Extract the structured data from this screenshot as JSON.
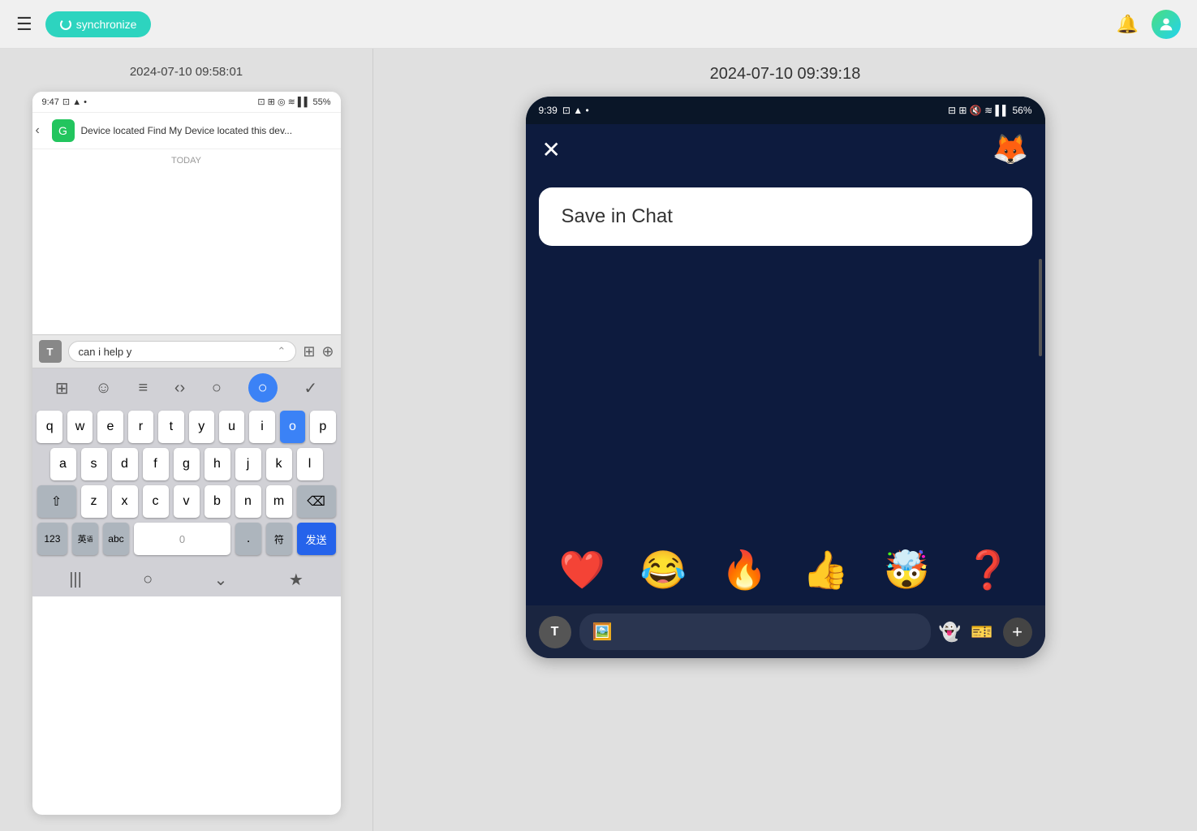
{
  "topbar": {
    "sync_label": "synchronize",
    "bell_label": "🔔",
    "avatar_label": "👤"
  },
  "left_panel": {
    "timestamp": "2024-07-10 09:58:01",
    "phone_status_time": "9:47",
    "phone_status_icons": "⊡ ▲ •",
    "phone_battery": "55%",
    "notification_title": "Device located",
    "notification_body": "Find My Device located this dev...",
    "today_label": "TODAY",
    "keyboard_suggestion": "can i help y",
    "keyboard_rows": [
      [
        "q",
        "w",
        "e",
        "r",
        "t",
        "y",
        "u",
        "i",
        "o",
        "p"
      ],
      [
        "a",
        "s",
        "d",
        "f",
        "g",
        "h",
        "j",
        "k",
        "l"
      ],
      [
        "z",
        "x",
        "c",
        "v",
        "b",
        "n",
        "m"
      ]
    ],
    "key_123": "123",
    "key_lang1": "英",
    "key_abc": "abc",
    "key_space_label": "0",
    "key_dot": ".",
    "key_special": "符",
    "key_send": "发送"
  },
  "right_panel": {
    "timestamp": "2024-07-10 09:39:18",
    "phone_status_time": "9:39",
    "phone_status_icons": "⊡ ▲ •",
    "phone_battery": "56%",
    "save_in_chat_text": "Save in Chat",
    "emojis": [
      "❤️",
      "😂",
      "🔥",
      "👍",
      "🤯",
      "❓"
    ],
    "chat_input_placeholder": ""
  }
}
